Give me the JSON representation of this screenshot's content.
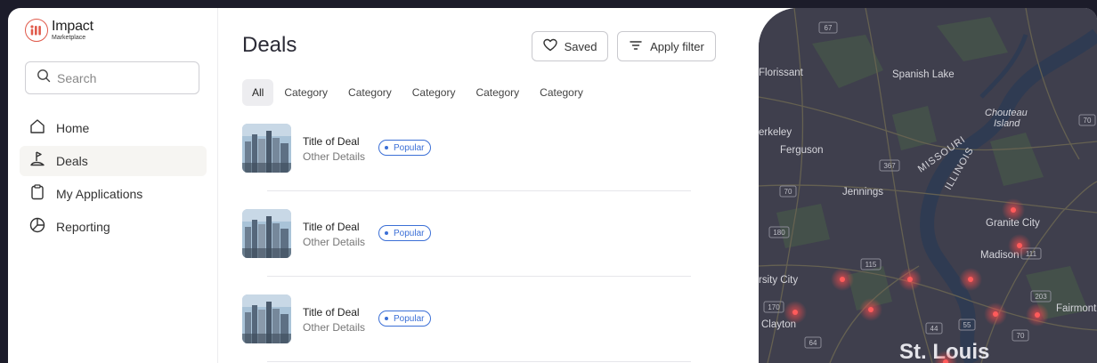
{
  "brand": {
    "name": "Impact",
    "sub": "Marketplace"
  },
  "search": {
    "placeholder": "Search"
  },
  "nav": [
    {
      "label": "Home",
      "icon": "home-icon",
      "active": false
    },
    {
      "label": "Deals",
      "icon": "deals-icon",
      "active": true
    },
    {
      "label": "My Applications",
      "icon": "clipboard-icon",
      "active": false
    },
    {
      "label": "Reporting",
      "icon": "pie-chart-icon",
      "active": false
    }
  ],
  "page": {
    "title": "Deals"
  },
  "toolbar": {
    "saved_label": "Saved",
    "filter_label": "Apply filter"
  },
  "chips": [
    "All",
    "Category",
    "Category",
    "Category",
    "Category",
    "Category"
  ],
  "deals": [
    {
      "title": "Title of Deal",
      "details": "Other Details",
      "badge": "Popular"
    },
    {
      "title": "Title of Deal",
      "details": "Other Details",
      "badge": "Popular"
    },
    {
      "title": "Title of Deal",
      "details": "Other Details",
      "badge": "Popular"
    }
  ],
  "map": {
    "places": [
      "Florissant",
      "Spanish Lake",
      "Chouteau",
      "Island",
      "erkeley",
      "Ferguson",
      "MISSOURI",
      "ILLINOIS",
      "Jennings",
      "Granite City",
      "Madison",
      "rsity City",
      "Clayton",
      "Fairmont",
      "St. Louis"
    ],
    "routes": [
      "67",
      "367",
      "70",
      "115",
      "180",
      "203",
      "111",
      "70",
      "55",
      "64",
      "44",
      "170",
      "70"
    ]
  },
  "colors": {
    "accent": "#3b6fd6",
    "brand": "#e05a4b",
    "map_bg": "#3f3f4d",
    "hotspot": "#ff4d4d"
  }
}
